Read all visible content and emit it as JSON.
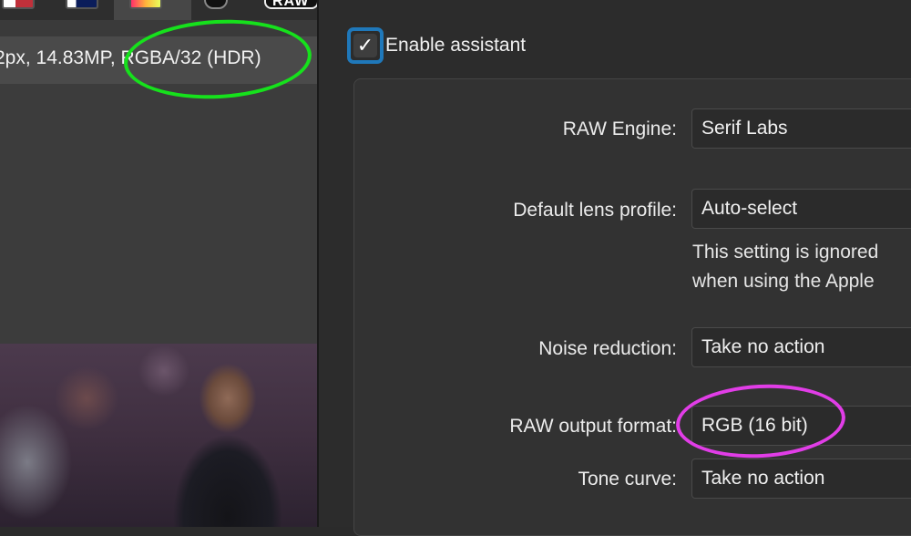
{
  "left_panel": {
    "toolbar": {
      "raw_badge": "RAW"
    },
    "info_bar": {
      "text": "2px, 14.83MP, RGBA/32 (HDR)"
    }
  },
  "right_panel": {
    "assistant": {
      "checked": true,
      "check_glyph": "✓",
      "label": "Enable assistant"
    },
    "settings": {
      "raw_engine": {
        "label": "RAW Engine:",
        "value": "Serif Labs"
      },
      "lens_profile": {
        "label": "Default lens profile:",
        "value": "Auto-select",
        "note_line1": "This setting is ignored",
        "note_line2": "when using the Apple"
      },
      "noise_reduction": {
        "label": "Noise reduction:",
        "value": "Take no action"
      },
      "raw_output_format": {
        "label": "RAW output format:",
        "value": "RGB (16 bit)"
      },
      "tone_curve": {
        "label": "Tone curve:",
        "value": "Take no action"
      }
    }
  },
  "annotations": {
    "green_highlight_color": "#16e11c",
    "magenta_highlight_color": "#e13de7",
    "focus_ring_color": "#1f78ba"
  }
}
